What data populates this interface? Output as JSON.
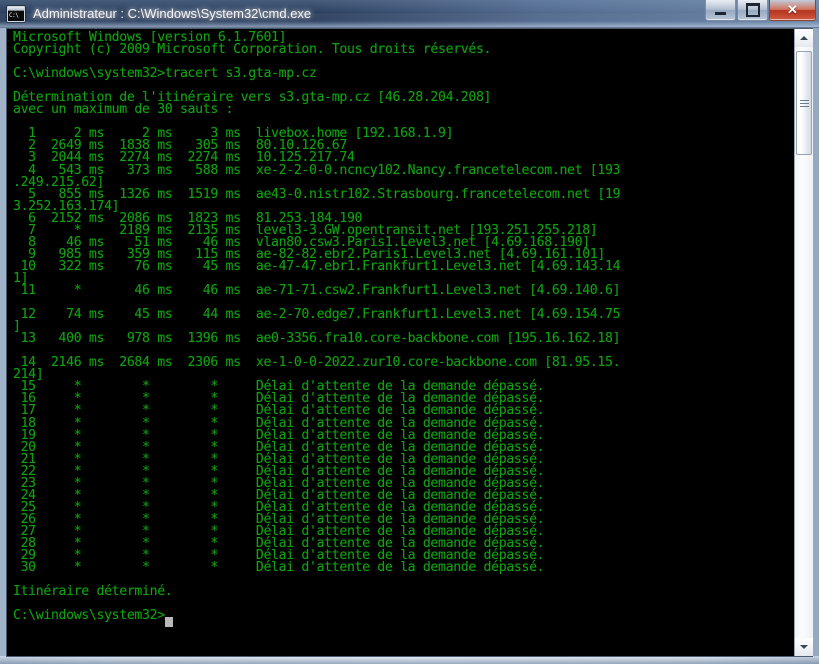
{
  "window": {
    "title": "Administrateur : C:\\Windows\\System32\\cmd.exe",
    "icon_name": "cmd-console-icon",
    "icon_glyph": "C:\\",
    "minimize_label": "",
    "maximize_label": "",
    "close_label": "✕"
  },
  "colors": {
    "console_background": "#000000",
    "console_text": "#12a012",
    "cursor": "#b9b9b9",
    "titlebar": "#24395a",
    "close_button": "#b73018"
  },
  "console": {
    "text": "Microsoft Windows [version 6.1.7601]\nCopyright (c) 2009 Microsoft Corporation. Tous droits réservés.\n\nC:\\windows\\system32>tracert s3.gta-mp.cz\n\nDétermination de l'itinéraire vers s3.gta-mp.cz [46.28.204.208]\navec un maximum de 30 sauts :\n\n  1     2 ms     2 ms     3 ms  livebox.home [192.168.1.9]\n  2  2649 ms  1838 ms   305 ms  80.10.126.67\n  3  2044 ms  2274 ms  2274 ms  10.125.217.74\n  4   543 ms   373 ms   588 ms  xe-2-2-0-0.ncncy102.Nancy.francetelecom.net [193\n.249.215.62]\n  5   855 ms  1326 ms  1519 ms  ae43-0.nistr102.Strasbourg.francetelecom.net [19\n3.252.163.174]\n  6  2152 ms  2086 ms  1823 ms  81.253.184.190\n  7     *     2189 ms  2135 ms  level3-3.GW.opentransit.net [193.251.255.218]\n  8    46 ms    51 ms    46 ms  vlan80.csw3.Paris1.Level3.net [4.69.168.190]\n  9   985 ms   359 ms   115 ms  ae-82-82.ebr2.Paris1.Level3.net [4.69.161.101]\n 10   322 ms    76 ms    45 ms  ae-47-47.ebr1.Frankfurt1.Level3.net [4.69.143.14\n1]\n 11     *       46 ms    46 ms  ae-71-71.csw2.Frankfurt1.Level3.net [4.69.140.6]\n\n 12    74 ms    45 ms    44 ms  ae-2-70.edge7.Frankfurt1.Level3.net [4.69.154.75\n]\n 13   400 ms   978 ms  1396 ms  ae0-3356.fra10.core-backbone.com [195.16.162.18]\n\n 14  2146 ms  2684 ms  2306 ms  xe-1-0-0-2022.zur10.core-backbone.com [81.95.15.\n214]\n 15     *        *        *     Délai d'attente de la demande dépassé.\n 16     *        *        *     Délai d'attente de la demande dépassé.\n 17     *        *        *     Délai d'attente de la demande dépassé.\n 18     *        *        *     Délai d'attente de la demande dépassé.\n 19     *        *        *     Délai d'attente de la demande dépassé.\n 20     *        *        *     Délai d'attente de la demande dépassé.\n 21     *        *        *     Délai d'attente de la demande dépassé.\n 22     *        *        *     Délai d'attente de la demande dépassé.\n 23     *        *        *     Délai d'attente de la demande dépassé.\n 24     *        *        *     Délai d'attente de la demande dépassé.\n 25     *        *        *     Délai d'attente de la demande dépassé.\n 26     *        *        *     Délai d'attente de la demande dépassé.\n 27     *        *        *     Délai d'attente de la demande dépassé.\n 28     *        *        *     Délai d'attente de la demande dépassé.\n 29     *        *        *     Délai d'attente de la demande dépassé.\n 30     *        *        *     Délai d'attente de la demande dépassé.\n\nItinéraire déterminé.\n\nC:\\windows\\system32>",
    "banner": {
      "os_version": "Microsoft Windows [version 6.1.7601]",
      "copyright": "Copyright (c) 2009 Microsoft Corporation. Tous droits réservés."
    },
    "prompt": "C:\\windows\\system32>",
    "command": "tracert s3.gta-mp.cz",
    "trace_header_line1": "Détermination de l'itinéraire vers s3.gta-mp.cz [46.28.204.208]",
    "trace_header_line2": "avec un maximum de 30 sauts :",
    "target_host": "s3.gta-mp.cz",
    "target_ip": "46.28.204.208",
    "max_hops": 30,
    "timeout_message": "Délai d'attente de la demande dépassé.",
    "completion_message": "Itinéraire déterminé.",
    "hops": [
      {
        "hop": 1,
        "rtt1": "2 ms",
        "rtt2": "2 ms",
        "rtt3": "3 ms",
        "host": "livebox.home",
        "ip": "192.168.1.9"
      },
      {
        "hop": 2,
        "rtt1": "2649 ms",
        "rtt2": "1838 ms",
        "rtt3": "305 ms",
        "host": "80.10.126.67",
        "ip": ""
      },
      {
        "hop": 3,
        "rtt1": "2044 ms",
        "rtt2": "2274 ms",
        "rtt3": "2274 ms",
        "host": "10.125.217.74",
        "ip": ""
      },
      {
        "hop": 4,
        "rtt1": "543 ms",
        "rtt2": "373 ms",
        "rtt3": "588 ms",
        "host": "xe-2-2-0-0.ncncy102.Nancy.francetelecom.net",
        "ip": "193.249.215.62"
      },
      {
        "hop": 5,
        "rtt1": "855 ms",
        "rtt2": "1326 ms",
        "rtt3": "1519 ms",
        "host": "ae43-0.nistr102.Strasbourg.francetelecom.net",
        "ip": "193.252.163.174"
      },
      {
        "hop": 6,
        "rtt1": "2152 ms",
        "rtt2": "2086 ms",
        "rtt3": "1823 ms",
        "host": "81.253.184.190",
        "ip": ""
      },
      {
        "hop": 7,
        "rtt1": "*",
        "rtt2": "2189 ms",
        "rtt3": "2135 ms",
        "host": "level3-3.GW.opentransit.net",
        "ip": "193.251.255.218"
      },
      {
        "hop": 8,
        "rtt1": "46 ms",
        "rtt2": "51 ms",
        "rtt3": "46 ms",
        "host": "vlan80.csw3.Paris1.Level3.net",
        "ip": "4.69.168.190"
      },
      {
        "hop": 9,
        "rtt1": "985 ms",
        "rtt2": "359 ms",
        "rtt3": "115 ms",
        "host": "ae-82-82.ebr2.Paris1.Level3.net",
        "ip": "4.69.161.101"
      },
      {
        "hop": 10,
        "rtt1": "322 ms",
        "rtt2": "76 ms",
        "rtt3": "45 ms",
        "host": "ae-47-47.ebr1.Frankfurt1.Level3.net",
        "ip": "4.69.143.141"
      },
      {
        "hop": 11,
        "rtt1": "*",
        "rtt2": "46 ms",
        "rtt3": "46 ms",
        "host": "ae-71-71.csw2.Frankfurt1.Level3.net",
        "ip": "4.69.140.6"
      },
      {
        "hop": 12,
        "rtt1": "74 ms",
        "rtt2": "45 ms",
        "rtt3": "44 ms",
        "host": "ae-2-70.edge7.Frankfurt1.Level3.net",
        "ip": "4.69.154.75"
      },
      {
        "hop": 13,
        "rtt1": "400 ms",
        "rtt2": "978 ms",
        "rtt3": "1396 ms",
        "host": "ae0-3356.fra10.core-backbone.com",
        "ip": "195.16.162.18"
      },
      {
        "hop": 14,
        "rtt1": "2146 ms",
        "rtt2": "2684 ms",
        "rtt3": "2306 ms",
        "host": "xe-1-0-0-2022.zur10.core-backbone.com",
        "ip": "81.95.15.214"
      },
      {
        "hop": 15,
        "rtt1": "*",
        "rtt2": "*",
        "rtt3": "*",
        "host": "Délai d'attente de la demande dépassé.",
        "ip": ""
      },
      {
        "hop": 16,
        "rtt1": "*",
        "rtt2": "*",
        "rtt3": "*",
        "host": "Délai d'attente de la demande dépassé.",
        "ip": ""
      },
      {
        "hop": 17,
        "rtt1": "*",
        "rtt2": "*",
        "rtt3": "*",
        "host": "Délai d'attente de la demande dépassé.",
        "ip": ""
      },
      {
        "hop": 18,
        "rtt1": "*",
        "rtt2": "*",
        "rtt3": "*",
        "host": "Délai d'attente de la demande dépassé.",
        "ip": ""
      },
      {
        "hop": 19,
        "rtt1": "*",
        "rtt2": "*",
        "rtt3": "*",
        "host": "Délai d'attente de la demande dépassé.",
        "ip": ""
      },
      {
        "hop": 20,
        "rtt1": "*",
        "rtt2": "*",
        "rtt3": "*",
        "host": "Délai d'attente de la demande dépassé.",
        "ip": ""
      },
      {
        "hop": 21,
        "rtt1": "*",
        "rtt2": "*",
        "rtt3": "*",
        "host": "Délai d'attente de la demande dépassé.",
        "ip": ""
      },
      {
        "hop": 22,
        "rtt1": "*",
        "rtt2": "*",
        "rtt3": "*",
        "host": "Délai d'attente de la demande dépassé.",
        "ip": ""
      },
      {
        "hop": 23,
        "rtt1": "*",
        "rtt2": "*",
        "rtt3": "*",
        "host": "Délai d'attente de la demande dépassé.",
        "ip": ""
      },
      {
        "hop": 24,
        "rtt1": "*",
        "rtt2": "*",
        "rtt3": "*",
        "host": "Délai d'attente de la demande dépassé.",
        "ip": ""
      },
      {
        "hop": 25,
        "rtt1": "*",
        "rtt2": "*",
        "rtt3": "*",
        "host": "Délai d'attente de la demande dépassé.",
        "ip": ""
      },
      {
        "hop": 26,
        "rtt1": "*",
        "rtt2": "*",
        "rtt3": "*",
        "host": "Délai d'attente de la demande dépassé.",
        "ip": ""
      },
      {
        "hop": 27,
        "rtt1": "*",
        "rtt2": "*",
        "rtt3": "*",
        "host": "Délai d'attente de la demande dépassé.",
        "ip": ""
      },
      {
        "hop": 28,
        "rtt1": "*",
        "rtt2": "*",
        "rtt3": "*",
        "host": "Délai d'attente de la demande dépassé.",
        "ip": ""
      },
      {
        "hop": 29,
        "rtt1": "*",
        "rtt2": "*",
        "rtt3": "*",
        "host": "Délai d'attente de la demande dépassé.",
        "ip": ""
      },
      {
        "hop": 30,
        "rtt1": "*",
        "rtt2": "*",
        "rtt3": "*",
        "host": "Délai d'attente de la demande dépassé.",
        "ip": ""
      }
    ]
  },
  "scrollbar": {
    "up_arrow": "up-arrow-icon",
    "down_arrow": "down-arrow-icon"
  }
}
